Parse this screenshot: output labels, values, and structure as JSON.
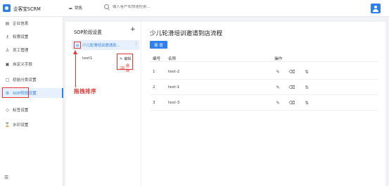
{
  "app": {
    "brand": "企客宝SCRM"
  },
  "header": {
    "nav_label": "销售",
    "search_placeholder": "输入客户和快速检索..."
  },
  "sidebar": {
    "items": [
      {
        "label": "企业信息",
        "icon": "building-icon"
      },
      {
        "label": "权限设置",
        "icon": "key-icon"
      },
      {
        "label": "员工管理",
        "icon": "user-icon"
      },
      {
        "label": "自定义字段",
        "icon": "form-icon"
      },
      {
        "label": "初始分类设置",
        "icon": "square-icon"
      },
      {
        "label": "SOP阶段设置",
        "icon": "stages-icon",
        "active": true
      },
      {
        "label": "标签设置",
        "icon": "tag-icon"
      },
      {
        "label": "水印设置",
        "icon": "hourglass-icon"
      }
    ]
  },
  "stage_panel": {
    "title": "SOP阶段设置",
    "add_symbol": "+",
    "stages": [
      {
        "label": "少儿轮滑培训邀请到...",
        "selected": true
      },
      {
        "label": "test1",
        "selected": false
      }
    ],
    "context_menu": {
      "edit": "编辑",
      "delete": "删除"
    },
    "annotation": "拖拽排序"
  },
  "content": {
    "title": "少儿轮滑培训邀请到店流程",
    "new_button": "新 增",
    "table": {
      "headers": {
        "index": "编号",
        "name": "名称",
        "ops": "操作"
      },
      "rows": [
        {
          "index": "1",
          "name": "test-2"
        },
        {
          "index": "2",
          "name": "test-1"
        },
        {
          "index": "3",
          "name": "test-3"
        }
      ]
    }
  },
  "colors": {
    "accent": "#2f80ed",
    "annotation": "#e53935"
  }
}
